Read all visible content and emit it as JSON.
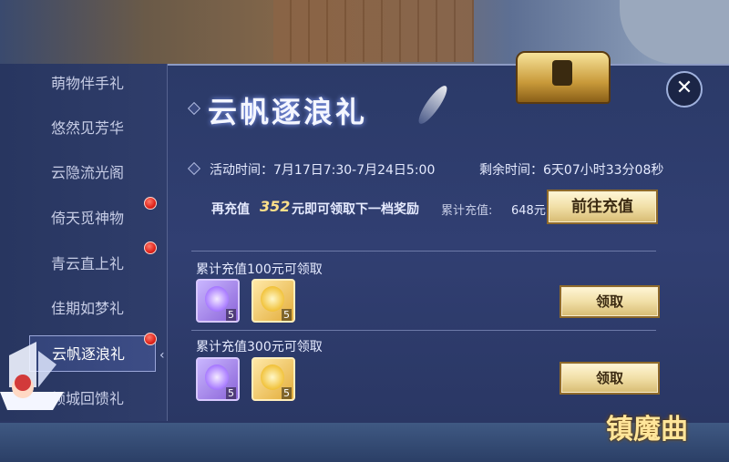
{
  "sidebar": {
    "items": [
      {
        "label": "萌物伴手礼",
        "badge": false
      },
      {
        "label": "悠然见芳华",
        "badge": false
      },
      {
        "label": "云隐流光阁",
        "badge": false
      },
      {
        "label": "倚天觅神物",
        "badge": true
      },
      {
        "label": "青云直上礼",
        "badge": true
      },
      {
        "label": "佳期如梦礼",
        "badge": false
      },
      {
        "label": "云帆逐浪礼",
        "badge": true,
        "active": true
      },
      {
        "label": "倾城回馈礼",
        "badge": false
      }
    ]
  },
  "header": {
    "title": "云帆逐浪礼",
    "close_symbol": "✕"
  },
  "info": {
    "activity_time": "活动时间：7月17日7:30-7月24日5:00",
    "remaining_time": "剩余时间：6天07小时33分08秒",
    "recharge_prefix": "再充值",
    "recharge_amount": "352",
    "recharge_suffix": "元即可领取下一档奖励",
    "total_label": "累计充值:",
    "total_value": "648元",
    "goto_recharge_label": "前往充值"
  },
  "rewards": [
    {
      "title": "累计充值100元可领取",
      "items": [
        {
          "icon": "purple-cat-doll",
          "count": "5"
        },
        {
          "icon": "yellow-chick-doll",
          "count": "5"
        }
      ],
      "claim_label": "领取"
    },
    {
      "title": "累计充值300元可领取",
      "items": [
        {
          "icon": "purple-cat-doll",
          "count": "5"
        },
        {
          "icon": "yellow-chick-doll",
          "count": "5"
        }
      ],
      "claim_label": "领取"
    }
  ],
  "brand": {
    "logo_text": "镇魔曲"
  },
  "colors": {
    "accent_gold": "#ffe08a",
    "badge_red": "#e0241c",
    "panel_bg": "#2f3d6b"
  }
}
